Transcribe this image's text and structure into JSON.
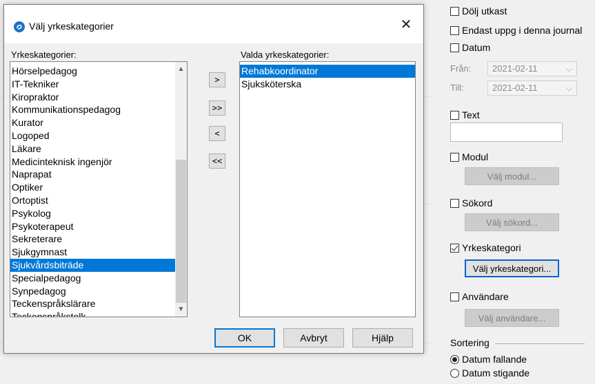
{
  "dialog": {
    "title": "Välj yrkeskategorier",
    "close_label": "✕",
    "available_label": "Yrkeskategorier:",
    "selected_label": "Valda yrkeskategorier:",
    "available_items": [
      "Hörselpedagog",
      "IT-Tekniker",
      "Kiropraktor",
      "Kommunikationspedagog",
      "Kurator",
      "Logoped",
      "Läkare",
      "Medicinteknisk ingenjör",
      "Naprapat",
      "Optiker",
      "Ortoptist",
      "Psykolog",
      "Psykoterapeut",
      "Sekreterare",
      "Sjukgymnast",
      "Sjukvårdsbiträde",
      "Specialpedagog",
      "Synpedagog",
      "Teckenspråkslärare",
      "Teckenspråkstolk"
    ],
    "available_selected": "Sjukvårdsbiträde",
    "selected_items": [
      "Rehabkoordinator",
      "Sjuksköterska"
    ],
    "selected_highlight": "Rehabkoordinator",
    "move_buttons": {
      "add": ">",
      "add_all": ">>",
      "remove": "<",
      "remove_all": "<<"
    },
    "buttons": {
      "ok": "OK",
      "cancel": "Avbryt",
      "help": "Hjälp"
    },
    "scroll_up": "▲",
    "scroll_down": "▼"
  },
  "filters": {
    "hide_drafts": {
      "label": "Dölj utkast",
      "checked": false
    },
    "only_in_journal": {
      "label": "Endast uppg i denna journal",
      "checked": false
    },
    "date": {
      "label": "Datum",
      "checked": false
    },
    "from_label": "Från:",
    "from_value": "2021-02-11",
    "to_label": "Till:",
    "to_value": "2021-02-11",
    "text": {
      "label": "Text",
      "checked": false
    },
    "module": {
      "label": "Modul",
      "checked": false
    },
    "choose_module": "Välj modul...",
    "keyword": {
      "label": "Sökord",
      "checked": false
    },
    "choose_keyword": "Välj sökord...",
    "profession": {
      "label": "Yrkeskategori",
      "checked": true
    },
    "choose_profession": "Välj yrkeskategori...",
    "user": {
      "label": "Användare",
      "checked": false
    },
    "choose_user": "Välj användare...",
    "sorting": {
      "title": "Sortering",
      "options": [
        "Datum fallande",
        "Datum stigande"
      ],
      "selected": "Datum fallande"
    }
  }
}
